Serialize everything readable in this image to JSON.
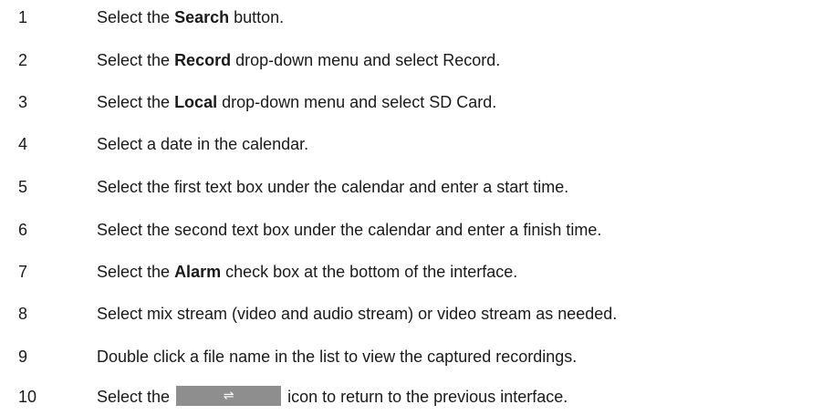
{
  "steps": [
    {
      "number": "1",
      "pre": "Select the ",
      "bold": "Search",
      "post": " button."
    },
    {
      "number": "2",
      "pre": "Select the ",
      "bold": "Record",
      "post": " drop-down menu and select Record."
    },
    {
      "number": "3",
      "pre": "Select the ",
      "bold": "Local",
      "post": " drop-down menu and select SD Card."
    },
    {
      "number": "4",
      "text": "Select a date in the calendar."
    },
    {
      "number": "5",
      "text": "Select the first text box under the calendar and enter a start time."
    },
    {
      "number": "6",
      "text": "Select the second text box under the calendar and enter a finish time."
    },
    {
      "number": "7",
      "pre": "Select the ",
      "bold": "Alarm",
      "post": " check box at the bottom of the interface."
    },
    {
      "number": "8",
      "text": "Select mix stream (video and audio stream) or video stream as needed."
    },
    {
      "number": "9",
      "text": "Double click a file name in the list to view the captured recordings."
    },
    {
      "number": "10",
      "pre": "Select the ",
      "icon_glyph": "⇌",
      "post": " icon to return to the previous interface."
    }
  ],
  "icons": {
    "step10_icon": "switch-arrows-icon",
    "step10_icon_color": "#8e8e8e"
  }
}
